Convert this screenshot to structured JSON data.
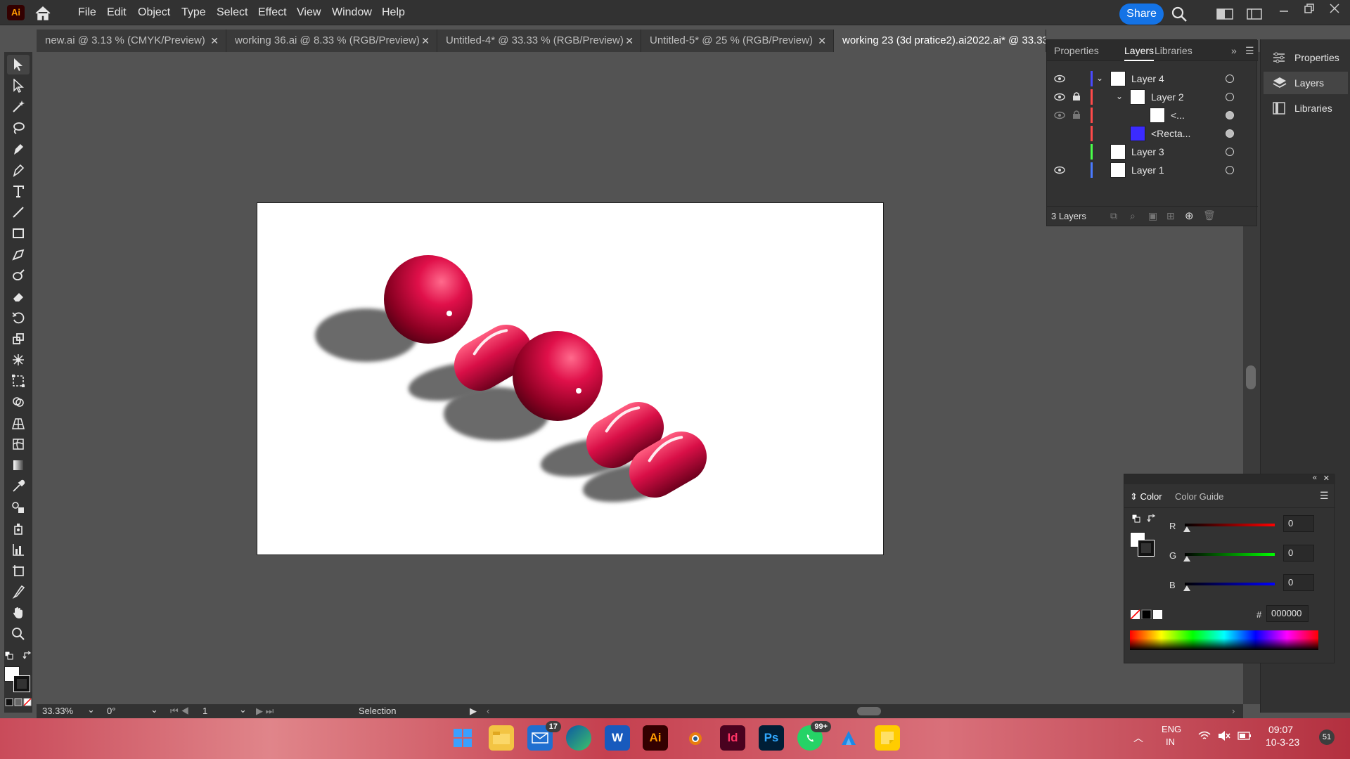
{
  "app": {
    "logo": "Ai"
  },
  "menu": [
    "File",
    "Edit",
    "Object",
    "Type",
    "Select",
    "Effect",
    "View",
    "Window",
    "Help"
  ],
  "header": {
    "share_label": "Share"
  },
  "tabs": [
    {
      "label": "new.ai @ 3.13 % (CMYK/Preview)"
    },
    {
      "label": "working 36.ai @ 8.33 % (RGB/Preview)"
    },
    {
      "label": "Untitled-4* @ 33.33 % (RGB/Preview)"
    },
    {
      "label": "Untitled-5* @ 25 % (RGB/Preview)"
    },
    {
      "label": "working 23 (3d pratice2).ai2022.ai* @ 33.33"
    }
  ],
  "layers_panel": {
    "tabs": [
      "Properties",
      "Layers",
      "Libraries"
    ],
    "rows": [
      {
        "name": "Layer 4",
        "color": "#4a4aff"
      },
      {
        "name": "Layer 2",
        "color": "#ff4a4a"
      },
      {
        "name": "<...",
        "color": "#ff4a4a"
      },
      {
        "name": "<Recta...",
        "color": "#ff4a4a"
      },
      {
        "name": "Layer 3",
        "color": "#4aff4a"
      },
      {
        "name": "Layer 1",
        "color": "#4a7aff"
      }
    ],
    "count": "3 Layers"
  },
  "right_dock": {
    "items": [
      "Properties",
      "Layers",
      "Libraries"
    ]
  },
  "color_panel": {
    "tabs": [
      "Color",
      "Color Guide"
    ],
    "r_label": "R",
    "g_label": "G",
    "b_label": "B",
    "r": "0",
    "g": "0",
    "b": "0",
    "hex_label": "#",
    "hex": "000000"
  },
  "status": {
    "zoom": "33.33%",
    "angle": "0°",
    "artboard": "1",
    "tool": "Selection"
  },
  "taskbar": {
    "apps": [
      {
        "name": "start-icon",
        "label": ""
      },
      {
        "name": "file-explorer-icon",
        "label": ""
      },
      {
        "name": "mail-icon",
        "label": "",
        "badge": "17"
      },
      {
        "name": "edge-icon",
        "label": ""
      },
      {
        "name": "word-icon",
        "label": "W"
      },
      {
        "name": "illustrator-icon",
        "label": "Ai"
      },
      {
        "name": "blender-icon",
        "label": ""
      },
      {
        "name": "indesign-icon",
        "label": "Id"
      },
      {
        "name": "photoshop-icon",
        "label": "Ps"
      },
      {
        "name": "whatsapp-icon",
        "label": "",
        "badge": "99+"
      },
      {
        "name": "maps-icon",
        "label": ""
      },
      {
        "name": "sticky-notes-icon",
        "label": ""
      }
    ],
    "lang_top": "ENG",
    "lang_bottom": "IN",
    "time": "09:07",
    "date": "10-3-23",
    "notif_count": "51"
  }
}
